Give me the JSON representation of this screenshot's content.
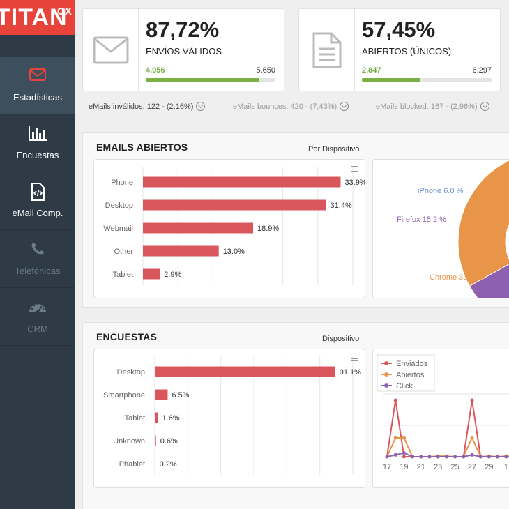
{
  "logo": {
    "main": "TITAN",
    "sup": "CX"
  },
  "sidebar": {
    "items": [
      {
        "label": "Estadísticas",
        "icon": "envelope-icon",
        "active": true
      },
      {
        "label": "Encuestas",
        "icon": "bar-chart-icon",
        "active": false
      },
      {
        "label": "eMail Comp.",
        "icon": "code-file-icon",
        "active": false
      },
      {
        "label": "Telefónicas",
        "icon": "phone-icon",
        "disabled": true
      },
      {
        "label": "CRM",
        "icon": "dashboard-icon",
        "disabled": true
      }
    ]
  },
  "stats": {
    "valid": {
      "percent": "87,72%",
      "label": "ENVÍOS VÁLIDOS",
      "left": "4.956",
      "right": "5.650",
      "fill": 0.8772,
      "icon": "envelope-icon"
    },
    "opened": {
      "percent": "57,45%",
      "label": "ABIERTOS (ÚNICOS)",
      "left": "2.847",
      "right": "6.297",
      "fill": 0.4521,
      "icon": "document-icon"
    }
  },
  "info": {
    "invalid": "eMails inválidos: 122 - (2,16%)",
    "bounces": "eMails bounces: 420 - (7,43%)",
    "blocked": "eMails blocked: 167 - (2,96%)"
  },
  "emails_panel": {
    "title": "EMAILS ABIERTOS",
    "subtitle": "Por Dispositivo"
  },
  "encuestas_panel": {
    "title": "ENCUESTAS",
    "subtitle": "Dispositivo"
  },
  "colors": {
    "bar": "#d9575c",
    "accent": "#e8433b",
    "green": "#79b143",
    "sidebar": "#2e3b47"
  },
  "chart_data": [
    {
      "type": "bar",
      "orientation": "horizontal",
      "categories": [
        "Phone",
        "Desktop",
        "Webmail",
        "Other",
        "Tablet"
      ],
      "values": [
        33.9,
        31.4,
        18.9,
        13.0,
        2.9
      ],
      "labels": [
        "33.9%",
        "31.4%",
        "18.9%",
        "13.0%",
        "2.9%"
      ],
      "xlim": [
        0,
        36
      ]
    },
    {
      "type": "pie",
      "donut": true,
      "slices": [
        {
          "label": "Chrome 33.1 %",
          "value": 33.1,
          "color": "#e8954a"
        },
        {
          "label": "Firefox 15.2 %",
          "value": 15.2,
          "color": "#9060b0"
        },
        {
          "label": "iPhone 6.0 %",
          "value": 6.0,
          "color": "#6a8fd2"
        },
        {
          "label": "",
          "value": 2.5,
          "color": "#8e8e8e"
        },
        {
          "label": "",
          "value": 1.0,
          "color": "#7dbf5a"
        },
        {
          "label": "",
          "value": 0.5,
          "color": "#555555"
        },
        {
          "label": "",
          "value": 0.5,
          "color": "#d9575c"
        }
      ]
    },
    {
      "type": "bar",
      "orientation": "horizontal",
      "categories": [
        "Desktop",
        "Smartphone",
        "Tablet",
        "Unknown",
        "Phablet"
      ],
      "values": [
        91.1,
        6.5,
        1.6,
        0.6,
        0.2
      ],
      "labels": [
        "91.1%",
        "6.5%",
        "1.6%",
        "0.6%",
        "0.2%"
      ],
      "xlim": [
        0,
        100
      ]
    },
    {
      "type": "line",
      "x": [
        "17",
        "18",
        "19",
        "20",
        "21",
        "22",
        "23",
        "24",
        "25",
        "26",
        "27",
        "28",
        "29",
        "30",
        "1",
        "2"
      ],
      "x_tick_labels": [
        "17",
        "19",
        "21",
        "23",
        "25",
        "27",
        "29",
        "1"
      ],
      "series": [
        {
          "name": "Enviados",
          "color": "#d9575c",
          "values": [
            0,
            90,
            0,
            0,
            0,
            0,
            0,
            0,
            0,
            0,
            90,
            0,
            0,
            0,
            0,
            0
          ]
        },
        {
          "name": "Abiertos",
          "color": "#e8954a",
          "values": [
            0,
            30,
            30,
            0,
            0,
            0,
            1,
            1,
            0,
            0,
            30,
            0,
            1,
            0,
            1,
            0
          ]
        },
        {
          "name": "Click",
          "color": "#9060b0",
          "values": [
            0,
            3,
            6,
            0,
            0,
            0,
            0,
            0,
            0,
            0,
            3,
            0,
            0,
            0,
            0,
            0
          ]
        }
      ],
      "ylim": [
        0,
        100
      ]
    }
  ]
}
